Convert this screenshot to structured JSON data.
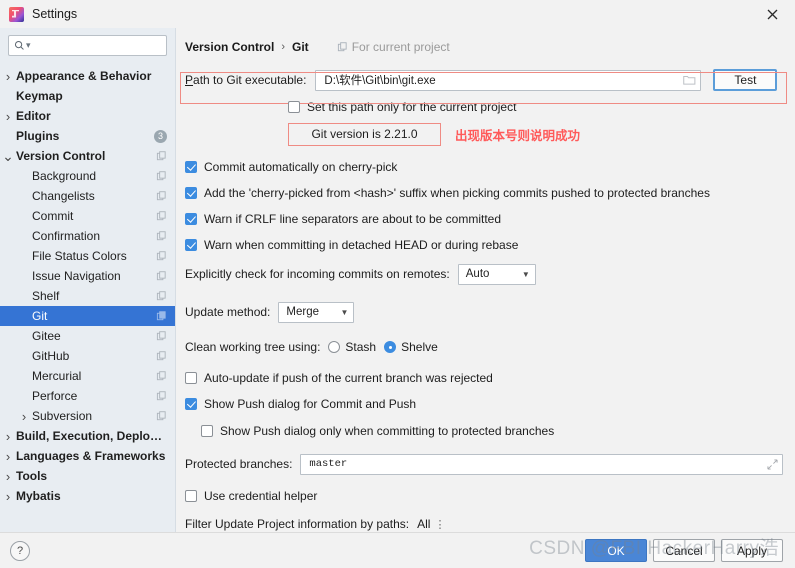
{
  "window": {
    "title": "Settings",
    "app_icon": "intellij-idea-icon",
    "close_icon": "close-icon"
  },
  "search": {
    "placeholder": "",
    "value": "",
    "icon": "search-icon"
  },
  "sidebar": {
    "items": [
      {
        "label": "Appearance & Behavior",
        "level": 0,
        "bold": true,
        "arrow": "chevron-right",
        "icon": null,
        "badge": null,
        "selected": false
      },
      {
        "label": "Keymap",
        "level": 0,
        "bold": true,
        "arrow": "",
        "icon": null,
        "badge": null,
        "selected": false
      },
      {
        "label": "Editor",
        "level": 0,
        "bold": true,
        "arrow": "chevron-right",
        "icon": null,
        "badge": null,
        "selected": false
      },
      {
        "label": "Plugins",
        "level": 0,
        "bold": true,
        "arrow": "",
        "icon": null,
        "badge": "3",
        "selected": false
      },
      {
        "label": "Version Control",
        "level": 0,
        "bold": true,
        "arrow": "chevron-down",
        "icon": "project-config-icon",
        "badge": null,
        "selected": false
      },
      {
        "label": "Background",
        "level": 1,
        "bold": false,
        "arrow": "",
        "icon": "project-config-icon",
        "badge": null,
        "selected": false
      },
      {
        "label": "Changelists",
        "level": 1,
        "bold": false,
        "arrow": "",
        "icon": "project-config-icon",
        "badge": null,
        "selected": false
      },
      {
        "label": "Commit",
        "level": 1,
        "bold": false,
        "arrow": "",
        "icon": "project-config-icon",
        "badge": null,
        "selected": false
      },
      {
        "label": "Confirmation",
        "level": 1,
        "bold": false,
        "arrow": "",
        "icon": "project-config-icon",
        "badge": null,
        "selected": false
      },
      {
        "label": "File Status Colors",
        "level": 1,
        "bold": false,
        "arrow": "",
        "icon": "project-config-icon",
        "badge": null,
        "selected": false
      },
      {
        "label": "Issue Navigation",
        "level": 1,
        "bold": false,
        "arrow": "",
        "icon": "project-config-icon",
        "badge": null,
        "selected": false
      },
      {
        "label": "Shelf",
        "level": 1,
        "bold": false,
        "arrow": "",
        "icon": "project-config-icon",
        "badge": null,
        "selected": false
      },
      {
        "label": "Git",
        "level": 1,
        "bold": false,
        "arrow": "",
        "icon": "project-config-icon",
        "badge": null,
        "selected": true
      },
      {
        "label": "Gitee",
        "level": 1,
        "bold": false,
        "arrow": "",
        "icon": "project-config-icon",
        "badge": null,
        "selected": false
      },
      {
        "label": "GitHub",
        "level": 1,
        "bold": false,
        "arrow": "",
        "icon": "project-config-icon",
        "badge": null,
        "selected": false
      },
      {
        "label": "Mercurial",
        "level": 1,
        "bold": false,
        "arrow": "",
        "icon": "project-config-icon",
        "badge": null,
        "selected": false
      },
      {
        "label": "Perforce",
        "level": 1,
        "bold": false,
        "arrow": "",
        "icon": "project-config-icon",
        "badge": null,
        "selected": false
      },
      {
        "label": "Subversion",
        "level": 1,
        "bold": false,
        "arrow": "chevron-right",
        "icon": "project-config-icon",
        "badge": null,
        "selected": false
      },
      {
        "label": "Build, Execution, Deployment",
        "level": 0,
        "bold": true,
        "arrow": "chevron-right",
        "icon": null,
        "badge": null,
        "selected": false
      },
      {
        "label": "Languages & Frameworks",
        "level": 0,
        "bold": true,
        "arrow": "chevron-right",
        "icon": null,
        "badge": null,
        "selected": false
      },
      {
        "label": "Tools",
        "level": 0,
        "bold": true,
        "arrow": "chevron-right",
        "icon": null,
        "badge": null,
        "selected": false
      },
      {
        "label": "Mybatis",
        "level": 0,
        "bold": true,
        "arrow": "chevron-right",
        "icon": null,
        "badge": null,
        "selected": false
      }
    ]
  },
  "main": {
    "breadcrumb": {
      "parent": "Version Control",
      "separator": "›",
      "current": "Git",
      "scope_label": "For current project",
      "scope_icon": "project-config-icon"
    },
    "path_row": {
      "label_prefix": "P",
      "label_rest": "ath to Git executable:",
      "value": "D:\\软件\\Git\\bin\\git.exe",
      "browse_icon": "folder-icon",
      "test_button": "Test"
    },
    "set_path_only": {
      "label": "Set this path only for the current project",
      "checked": false
    },
    "git_version": {
      "text": "Git version is 2.21.0"
    },
    "annotation": {
      "text": "出现版本号则说明成功",
      "color": "#ff5a5a"
    },
    "checkboxes": [
      {
        "label": "Commit automatically on cherry-pick",
        "checked": true
      },
      {
        "label": "Add the 'cherry-picked from <hash>' suffix when picking commits pushed to protected branches",
        "checked": true
      },
      {
        "label": "Warn if CRLF line separators are about to be committed",
        "checked": true
      },
      {
        "label": "Warn when committing in detached HEAD or during rebase",
        "checked": true
      }
    ],
    "incoming_commits": {
      "label": "Explicitly check for incoming commits on remotes:",
      "value": "Auto"
    },
    "update_method": {
      "label": "Update method:",
      "value": "Merge"
    },
    "clean_tree": {
      "label": "Clean working tree using:",
      "options": [
        "Stash",
        "Shelve"
      ],
      "selected": "Shelve"
    },
    "auto_update": {
      "label": "Auto-update if push of the current branch was rejected",
      "checked": false
    },
    "show_push_dialog": {
      "label": "Show Push dialog for Commit and Push",
      "checked": true
    },
    "show_push_protected": {
      "label": "Show Push dialog only when committing to protected branches",
      "checked": false
    },
    "protected_branches": {
      "label": "Protected branches:",
      "value": "master",
      "expand_icon": "expand-icon"
    },
    "credential_helper": {
      "label": "Use credential helper",
      "checked": false
    },
    "filter_paths": {
      "label": "Filter Update Project information by paths:",
      "value": "All",
      "caret_icon": "updown-caret-icon"
    }
  },
  "footer": {
    "help_label": "?",
    "ok": "OK",
    "cancel": "Cancel",
    "apply": "Apply"
  },
  "watermark": {
    "text": "CSDN @FBI HackerHarry浩"
  }
}
